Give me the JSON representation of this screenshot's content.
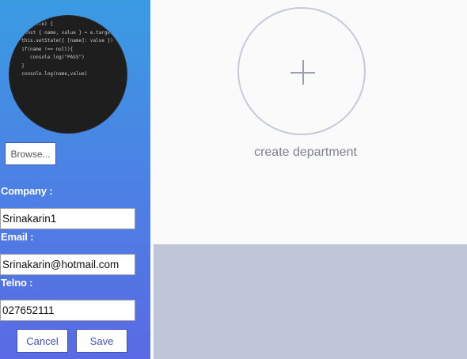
{
  "sidebar": {
    "avatar_code_lines": [
      "onChange(e) {",
      "  const { name, value } = e.target",
      "  this.setState({ [name]: value })",
      "  if(name !== null){",
      "     console.log(\"PASS\")",
      "  }",
      "  console.log(name,value)"
    ],
    "browse_label": "Browse...",
    "company": {
      "label": "Company :",
      "value": "Srinakarin1"
    },
    "email": {
      "label": "Email :",
      "value": "Srinakarin@hotmail.com"
    },
    "telno": {
      "label": "Telno :",
      "value": "027652111"
    },
    "cancel_label": "Cancel",
    "save_label": "Save",
    "colors": {
      "gradient_top": "#3a9be3",
      "gradient_bottom": "#5a6ae4",
      "button_accent": "#3f51b5"
    }
  },
  "main": {
    "create_label": "create department",
    "create_icon": "plus-icon",
    "colors": {
      "circle_border": "#c4cad8",
      "bottom_panel": "#bec6d8"
    }
  }
}
